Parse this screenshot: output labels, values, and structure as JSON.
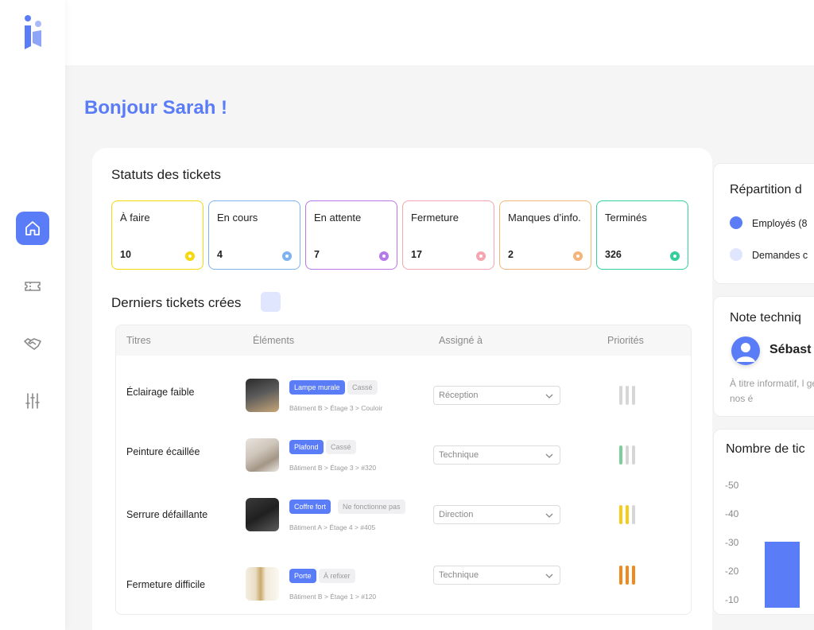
{
  "greeting": "Bonjour Sarah !",
  "statuses_title": "Statuts des tickets",
  "statuses": [
    {
      "label": "À faire",
      "count": "10",
      "color": "#f5d90a"
    },
    {
      "label": "En cours",
      "count": "4",
      "color": "#7fb2f0"
    },
    {
      "label": "En attente",
      "count": "7",
      "color": "#b679e8"
    },
    {
      "label": "Fermeture",
      "count": "17",
      "color": "#f4a5b0"
    },
    {
      "label": "Manques d’info.",
      "count": "2",
      "color": "#f5b47a"
    },
    {
      "label": "Terminés",
      "count": "326",
      "color": "#34cf9a"
    }
  ],
  "recent_title": "Derniers tickets crées",
  "table": {
    "headers": [
      "Titres",
      "Éléments",
      "Assigné à",
      "Priorités"
    ],
    "rows": [
      {
        "title": "Éclairage faible",
        "tag1": "Lampe murale",
        "tag2": "Cassé",
        "path": "Bâtiment B > Étage 3 > Couloir",
        "assignee": "Réception",
        "priority": 0
      },
      {
        "title": "Peinture écaillée",
        "tag1": "Plafond",
        "tag2": "Cassé",
        "path": "Bâtiment B > Étage 3 > #320",
        "assignee": "Technique",
        "priority": 1
      },
      {
        "title": "Serrure défaillante",
        "tag1": "Coffre fort",
        "tag2": "Ne fonctionne pas",
        "path": "Bâtiment A > Étage 4 > #405",
        "assignee": "Direction",
        "priority": 2
      },
      {
        "title": "Fermeture difficile",
        "tag1": "Porte",
        "tag2": "À refixer",
        "path": "Bâtiment B > Étage 1 > #120",
        "assignee": "Technique",
        "priority": 3
      }
    ]
  },
  "panels": {
    "repartition_title": "Répartition d",
    "legend": [
      {
        "label": "Employés (8",
        "color": "#5b7cf7"
      },
      {
        "label": "Demandes c",
        "color": "#dfe6fd"
      }
    ],
    "note_title": "Note techniq",
    "note_name": "Sébast",
    "note_text": "À titre informatif, l générale de nos é",
    "count_title": "Nombre de tic",
    "chart_data": {
      "type": "bar",
      "title": "Nombre de tic",
      "yticks": [
        "-50",
        "-40",
        "-30",
        "-20",
        "-10"
      ],
      "values": [
        27
      ],
      "ylim": [
        0,
        50
      ]
    }
  }
}
